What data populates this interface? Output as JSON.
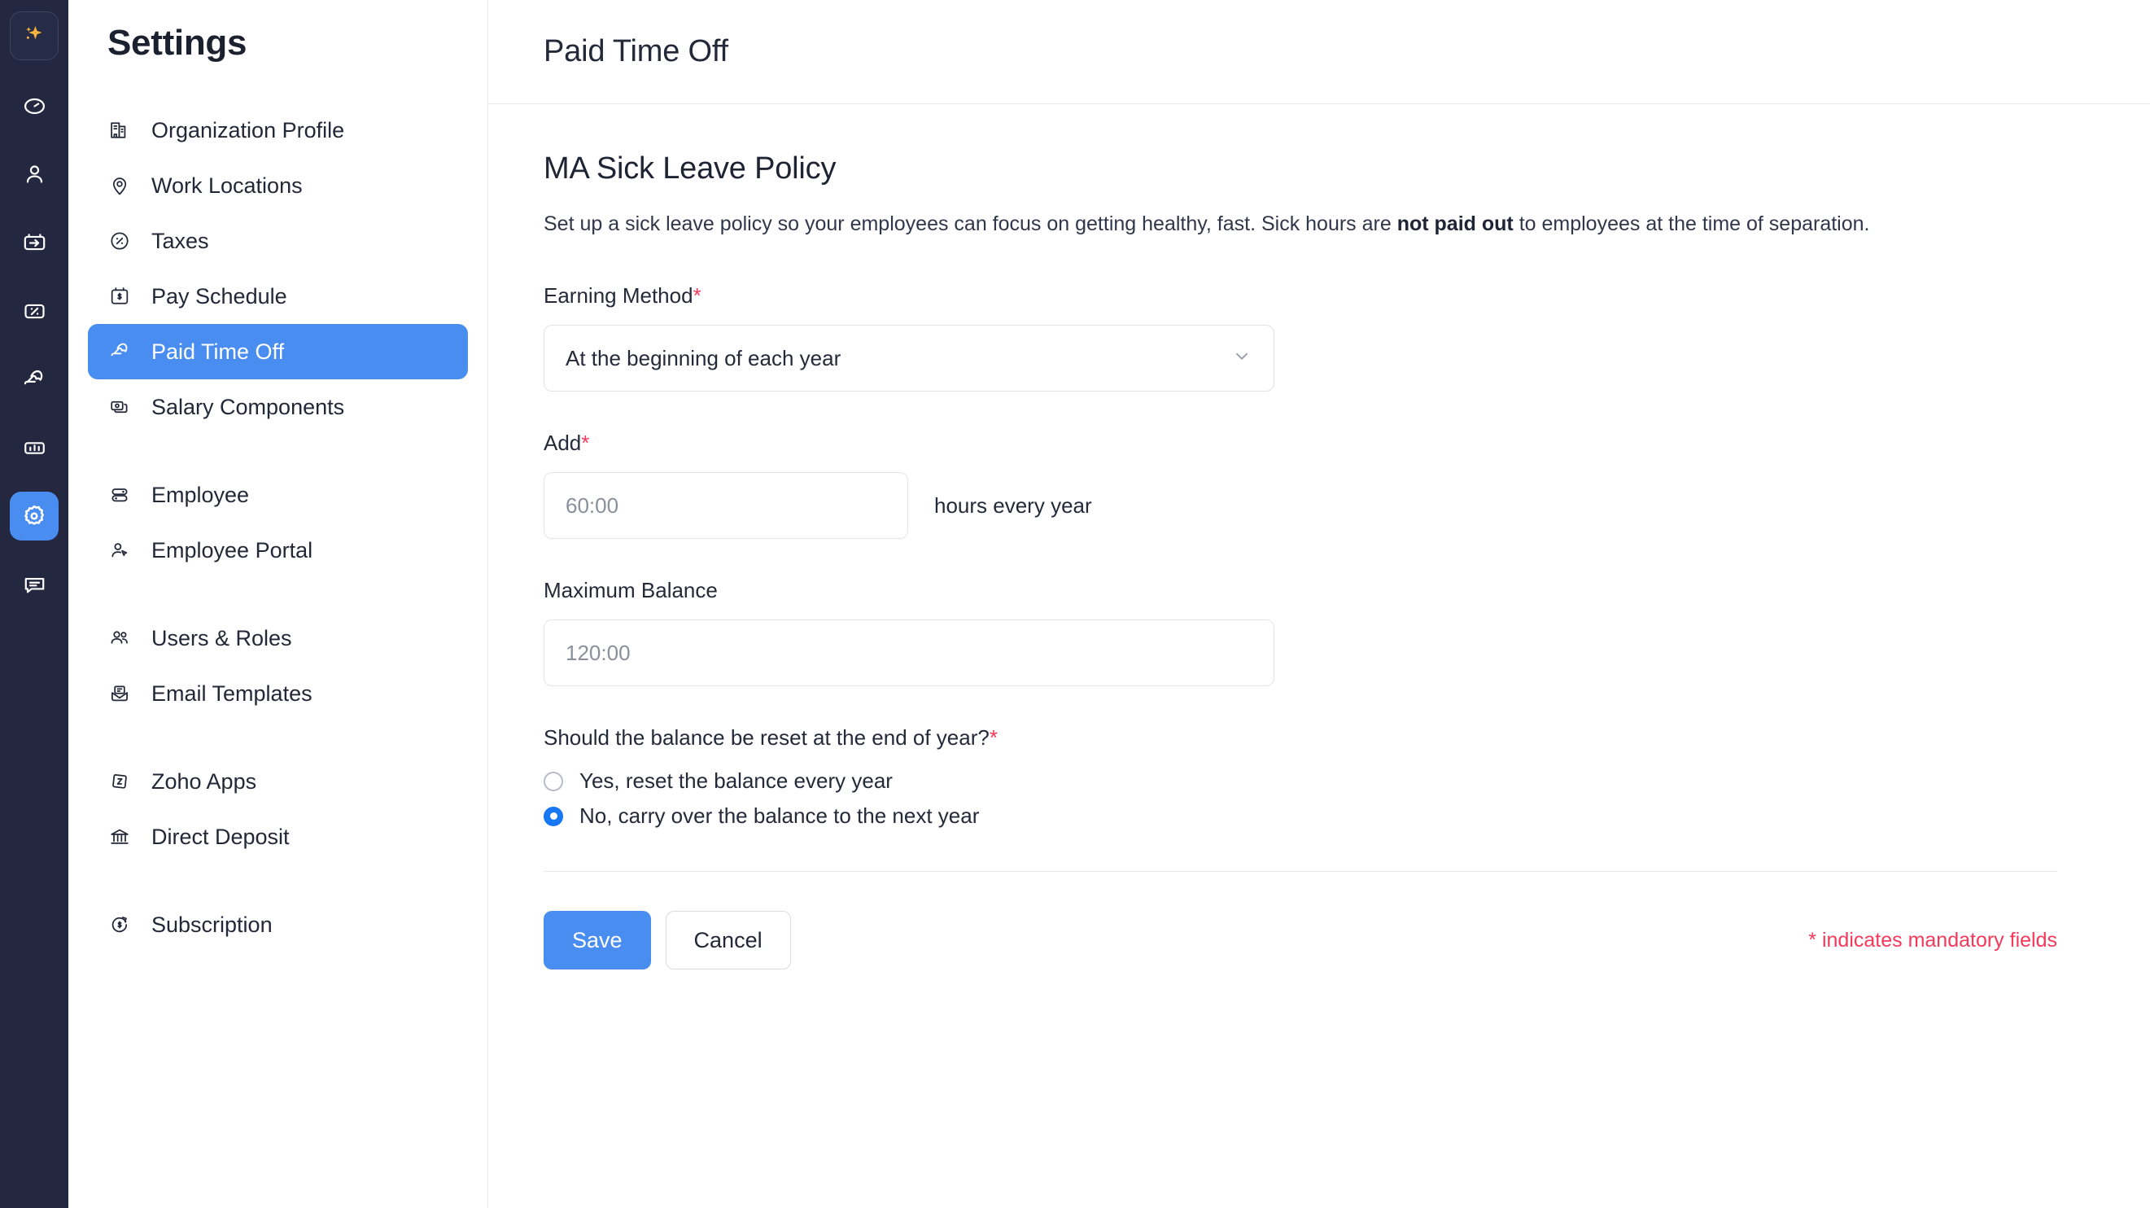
{
  "rail": {
    "items": [
      {
        "name": "sparkle-icon",
        "active": false,
        "highlight": true
      },
      {
        "name": "clock-icon",
        "active": false,
        "highlight": false
      },
      {
        "name": "person-icon",
        "active": false,
        "highlight": false
      },
      {
        "name": "card-arrow-icon",
        "active": false,
        "highlight": false
      },
      {
        "name": "percent-card-icon",
        "active": false,
        "highlight": false
      },
      {
        "name": "umbrella-icon",
        "active": false,
        "highlight": false
      },
      {
        "name": "bar-chart-icon",
        "active": false,
        "highlight": false
      },
      {
        "name": "gear-icon",
        "active": true,
        "highlight": false
      },
      {
        "name": "chat-icon",
        "active": false,
        "highlight": false
      }
    ]
  },
  "sidebar": {
    "title": "Settings",
    "items": [
      {
        "label": "Organization Profile",
        "icon": "building-icon",
        "active": false,
        "spacer_after": false
      },
      {
        "label": "Work Locations",
        "icon": "map-pin-icon",
        "active": false,
        "spacer_after": false
      },
      {
        "label": "Taxes",
        "icon": "percent-circle-icon",
        "active": false,
        "spacer_after": false
      },
      {
        "label": "Pay Schedule",
        "icon": "calendar-dollar-icon",
        "active": false,
        "spacer_after": false
      },
      {
        "label": "Paid Time Off",
        "icon": "beach-umbrella-icon",
        "active": true,
        "spacer_after": false
      },
      {
        "label": "Salary Components",
        "icon": "cards-stack-icon",
        "active": false,
        "spacer_after": true
      },
      {
        "label": "Employee",
        "icon": "toggle-rows-icon",
        "active": false,
        "spacer_after": false
      },
      {
        "label": "Employee Portal",
        "icon": "person-cursor-icon",
        "active": false,
        "spacer_after": true
      },
      {
        "label": "Users & Roles",
        "icon": "users-icon",
        "active": false,
        "spacer_after": false
      },
      {
        "label": "Email Templates",
        "icon": "envelope-icon",
        "active": false,
        "spacer_after": true
      },
      {
        "label": "Zoho Apps",
        "icon": "zoho-z-icon",
        "active": false,
        "spacer_after": false
      },
      {
        "label": "Direct Deposit",
        "icon": "bank-icon",
        "active": false,
        "spacer_after": true
      },
      {
        "label": "Subscription",
        "icon": "refresh-dollar-icon",
        "active": false,
        "spacer_after": false
      }
    ]
  },
  "main": {
    "header_title": "Paid Time Off",
    "section_title": "MA Sick Leave Policy",
    "description": {
      "before": "Set up a sick leave policy so your employees can focus on getting healthy, fast. Sick hours are ",
      "bold": "not paid out",
      "after": " to employees at the time of separation."
    },
    "earning_method": {
      "label": "Earning Method",
      "required_marker": "*",
      "value": "At the beginning of each year",
      "chevron": "chevron-down-icon"
    },
    "add_field": {
      "label": "Add",
      "required_marker": "*",
      "value": "60:00",
      "placeholder": "60:00",
      "suffix": "hours every year"
    },
    "maximum_balance": {
      "label": "Maximum Balance",
      "value": "120:00",
      "placeholder": "120:00"
    },
    "reset_question": {
      "label": "Should the balance be reset at the end of year?",
      "required_marker": "*",
      "options": [
        {
          "label": "Yes, reset the balance every year",
          "selected": false
        },
        {
          "label": "No, carry over the balance to the next year",
          "selected": true
        }
      ]
    },
    "actions": {
      "save_label": "Save",
      "cancel_label": "Cancel",
      "mandatory_note": "* indicates mandatory fields"
    }
  },
  "colors": {
    "rail_bg": "#232840",
    "accent_blue": "#4a8df0",
    "radio_blue": "#1877f2",
    "required_red": "#f4395b",
    "sparkle_gold": "#f6b33d",
    "text_dark": "#232838",
    "border": "#e6e8ec"
  }
}
